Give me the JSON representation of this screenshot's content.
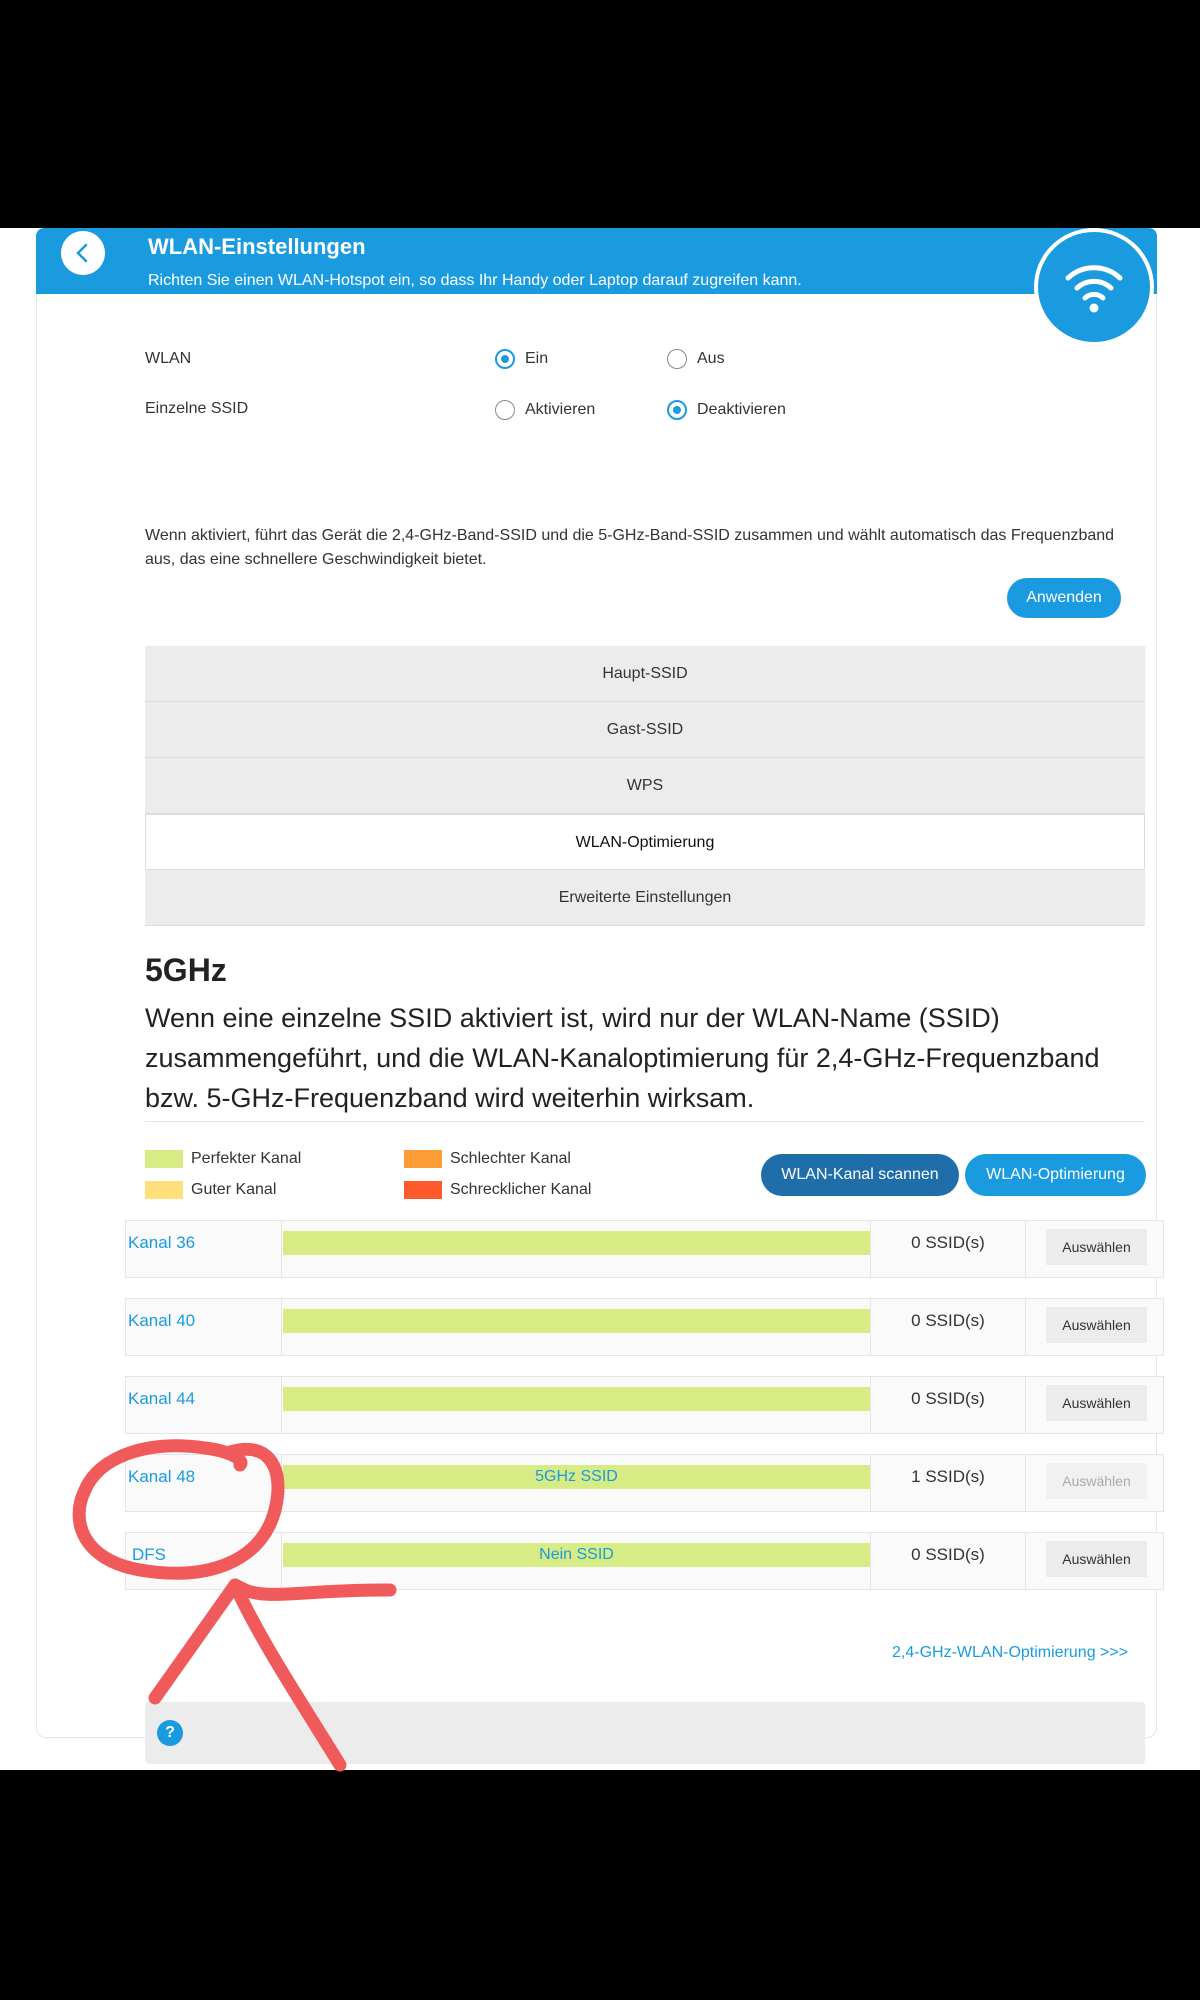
{
  "header": {
    "title": "WLAN-Einstellungen",
    "subtitle": "Richten Sie einen WLAN-Hotspot ein, so dass Ihr Handy oder Laptop darauf zugreifen kann."
  },
  "settings": {
    "wlan": {
      "label": "WLAN",
      "on": "Ein",
      "off": "Aus",
      "selected": "Ein"
    },
    "single_ssid": {
      "label": "Einzelne SSID",
      "enable": "Aktivieren",
      "disable": "Deaktivieren",
      "selected": "Deaktivieren"
    },
    "description": "Wenn aktiviert, führt das Gerät die 2,4-GHz-Band-SSID und die 5-GHz-Band-SSID zusammen und wählt automatisch das Frequenzband aus, das eine schnellere Geschwindigkeit bietet.",
    "apply": "Anwenden"
  },
  "menu": {
    "items": [
      "Haupt-SSID",
      "Gast-SSID",
      "WPS",
      "WLAN-Optimierung",
      "Erweiterte Einstellungen"
    ],
    "active": "WLAN-Optimierung"
  },
  "band": {
    "title": "5GHz",
    "info": "Wenn eine einzelne SSID aktiviert ist, wird nur der WLAN-Name (SSID) zusammengeführt, und die WLAN-Kanaloptimierung für 2,4-GHz-Frequenzband bzw. 5-GHz-Frequenzband wird weiterhin wirksam."
  },
  "legend": {
    "perfect": "Perfekter Kanal",
    "good": "Guter Kanal",
    "bad": "Schlechter Kanal",
    "terrible": "Schrecklicher Kanal",
    "colors": {
      "perfect": "#d7ec84",
      "good": "#fde07a",
      "bad": "#fd9b35",
      "terrible": "#fe5a2e"
    }
  },
  "actions": {
    "scan": "WLAN-Kanal scannen",
    "optimize": "WLAN-Optimierung"
  },
  "channels": [
    {
      "name": "Kanal  36",
      "bar": "",
      "count": "0 SSID(s)",
      "select": "Auswählen",
      "enabled": true
    },
    {
      "name": "Kanal  40",
      "bar": "",
      "count": "0 SSID(s)",
      "select": "Auswählen",
      "enabled": true
    },
    {
      "name": "Kanal  44",
      "bar": "",
      "count": "0 SSID(s)",
      "select": "Auswählen",
      "enabled": true
    },
    {
      "name": "Kanal  48",
      "bar": "5GHz SSID",
      "count": "1 SSID(s)",
      "select": "Auswählen",
      "enabled": false
    },
    {
      "name": "DFS",
      "bar": "Nein SSID",
      "count": "0 SSID(s)",
      "select": "Auswählen",
      "enabled": true
    }
  ],
  "link_24": "2,4-GHz-WLAN-Optimierung >>>",
  "help_icon": "?",
  "annotation_color": "#f05a5a"
}
